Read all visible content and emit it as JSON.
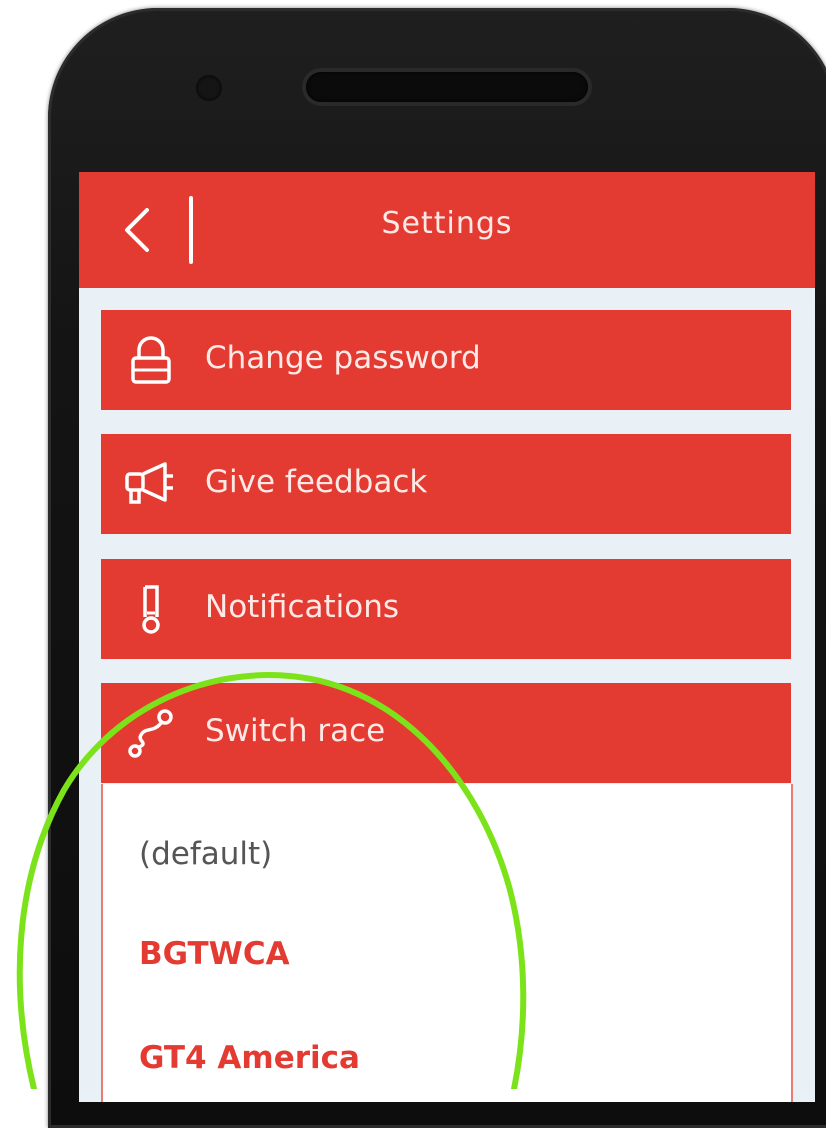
{
  "header": {
    "title": "Settings",
    "back_icon": "chevron-left-icon"
  },
  "menu": {
    "items": [
      {
        "label": "Change password",
        "icon": "lock-icon"
      },
      {
        "label": "Give feedback",
        "icon": "megaphone-icon"
      },
      {
        "label": "Notifications",
        "icon": "thermometer-icon"
      },
      {
        "label": "Switch race",
        "icon": "route-icon"
      }
    ]
  },
  "race_list": {
    "options": [
      "(default)",
      "BGTWCA",
      "GT4 America"
    ]
  },
  "colors": {
    "accent": "#e33b31",
    "screen_background": "#eaf1f6",
    "highlight": "#7ce31a",
    "menu_text": "#ffe9e6"
  }
}
